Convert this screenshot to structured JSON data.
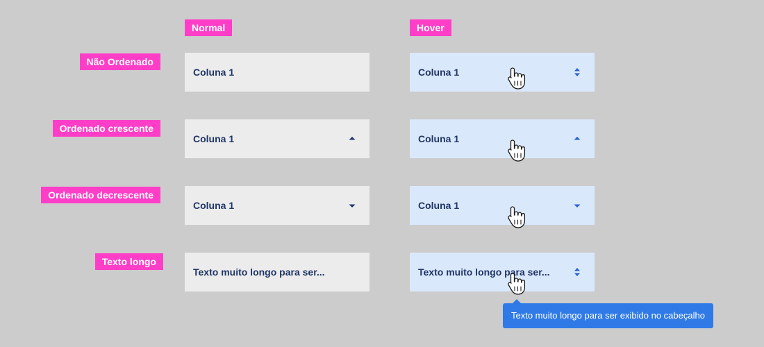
{
  "columns": {
    "normal": "Normal",
    "hover": "Hover"
  },
  "rows": [
    {
      "label": "Não Ordenado",
      "cell_text": "Coluna 1",
      "sort": "unsorted",
      "sort_icon": "sort-both-icon"
    },
    {
      "label": "Ordenado crescente",
      "cell_text": "Coluna 1",
      "sort": "ascending",
      "sort_icon": "sort-up-icon"
    },
    {
      "label": "Ordenado decrescente",
      "cell_text": "Coluna 1",
      "sort": "descending",
      "sort_icon": "sort-down-icon"
    },
    {
      "label": "Texto longo",
      "cell_text": "Texto muito longo para ser...",
      "sort": "unsorted",
      "sort_icon": "sort-both-icon"
    }
  ],
  "tooltip": {
    "text": "Texto muito longo para ser exibido no cabeçalho"
  },
  "colors": {
    "tag": "#ff3ec8",
    "normal_bg": "#ececec",
    "hover_bg": "#dae8fb",
    "text": "#1f3566",
    "icon": "#2a62c8",
    "tooltip": "#2f7ae6"
  }
}
